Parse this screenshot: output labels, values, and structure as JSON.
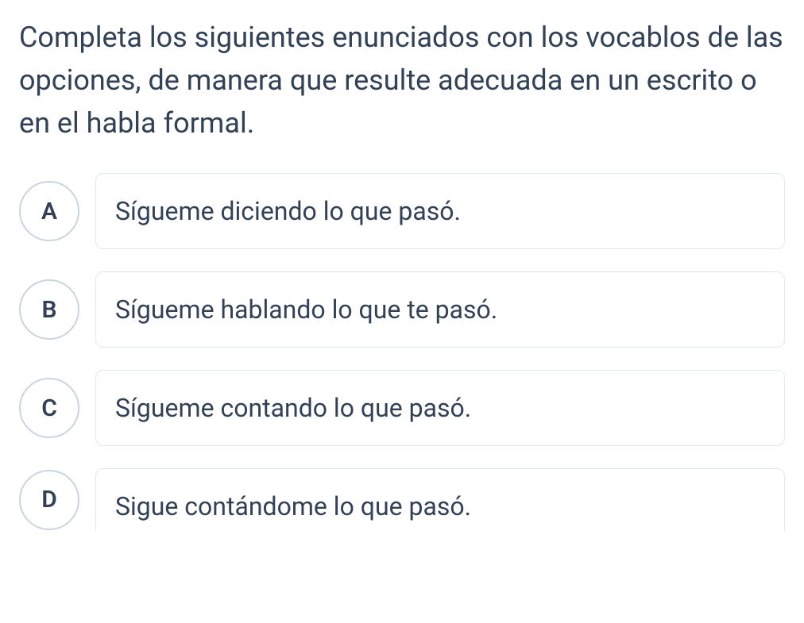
{
  "question": {
    "text": " Completa los siguientes enunciados con los vocablos de las opciones, de manera que resulte adecuada en un escrito o en el habla formal."
  },
  "options": [
    {
      "letter": "A",
      "text": "Sígueme diciendo lo que pasó."
    },
    {
      "letter": "B",
      "text": "Sígueme hablando lo que te pasó."
    },
    {
      "letter": "C",
      "text": "Sígueme contando lo que pasó."
    },
    {
      "letter": "D",
      "text": "Sigue contándome lo que pasó."
    }
  ]
}
